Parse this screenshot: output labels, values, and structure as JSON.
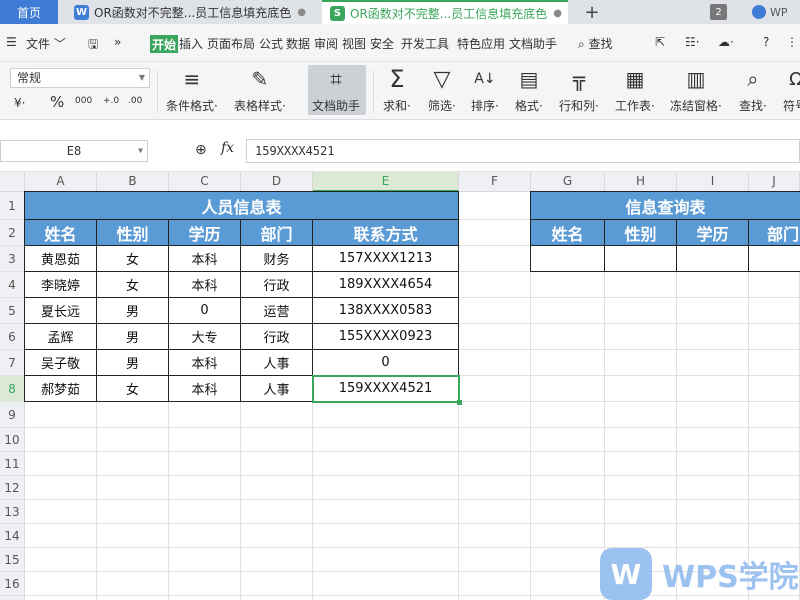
{
  "tabs": {
    "home": "首页",
    "doc1": "OR函数对不完整...员工信息填充底色",
    "doc2": "OR函数对不完整...员工信息填充底色",
    "doc1_icon": "W",
    "doc2_icon": "S",
    "add": "+",
    "window_count": "2",
    "wps": "WP"
  },
  "menu": {
    "file": "文件",
    "more": "»",
    "start": "开始",
    "items": [
      "插入",
      "页面布局",
      "公式",
      "数据",
      "审阅",
      "视图",
      "安全",
      "开发工具",
      "特色应用",
      "文档助手"
    ],
    "search": "查找"
  },
  "ribbon": {
    "number_format": "常规",
    "small_icons": [
      "¥·",
      "%",
      "000",
      "+.0",
      ".00"
    ],
    "buttons": [
      {
        "name": "conditional-format-button",
        "label": "条件格式·",
        "icon": "≡"
      },
      {
        "name": "table-style-button",
        "label": "表格样式·",
        "icon": "✎"
      },
      {
        "name": "doc-assistant-button",
        "label": "文档助手",
        "icon": "⌗"
      },
      {
        "name": "sum-button",
        "label": "求和·",
        "icon": "Σ"
      },
      {
        "name": "filter-button",
        "label": "筛选·",
        "icon": "▽"
      },
      {
        "name": "sort-button",
        "label": "排序·",
        "icon": "A↓"
      },
      {
        "name": "format-button",
        "label": "格式·",
        "icon": "▤"
      },
      {
        "name": "row-col-button",
        "label": "行和列·",
        "icon": "╦"
      },
      {
        "name": "worksheet-button",
        "label": "工作表·",
        "icon": "▦"
      },
      {
        "name": "freeze-pane-button",
        "label": "冻结窗格·",
        "icon": "▥"
      },
      {
        "name": "find-button",
        "label": "查找·",
        "icon": "⌕"
      },
      {
        "name": "symbol-button",
        "label": "符号",
        "icon": "Ω"
      }
    ]
  },
  "formula_bar": {
    "cell_ref": "E8",
    "fx": "fx",
    "value": "159XXXX4521"
  },
  "columns": [
    "A",
    "B",
    "C",
    "D",
    "E",
    "F",
    "G",
    "H",
    "I",
    "J"
  ],
  "rows": [
    "1",
    "2",
    "3",
    "4",
    "5",
    "6",
    "7",
    "8",
    "9",
    "10",
    "11",
    "12",
    "13",
    "14",
    "15",
    "16",
    "17"
  ],
  "table": {
    "title": "人员信息表",
    "headers": [
      "姓名",
      "性别",
      "学历",
      "部门",
      "联系方式"
    ],
    "data": [
      [
        "黄恩茹",
        "女",
        "本科",
        "财务",
        "157XXXX1213"
      ],
      [
        "李晓婷",
        "女",
        "本科",
        "行政",
        "189XXXX4654"
      ],
      [
        "夏长远",
        "男",
        "0",
        "运营",
        "138XXXX0583"
      ],
      [
        "孟辉",
        "男",
        "大专",
        "行政",
        "155XXXX0923"
      ],
      [
        "吴子敬",
        "男",
        "本科",
        "人事",
        "0"
      ],
      [
        "郝梦茹",
        "女",
        "本科",
        "人事",
        "159XXXX4521"
      ]
    ]
  },
  "lookup": {
    "title": "信息查询表",
    "headers": [
      "姓名",
      "性别",
      "学历",
      "部门"
    ]
  },
  "watermark": "WPS学院",
  "colors": {
    "accent": "#3aa55c",
    "header_fill": "#5b9bd5",
    "tab_active": "#3f7cd6"
  }
}
